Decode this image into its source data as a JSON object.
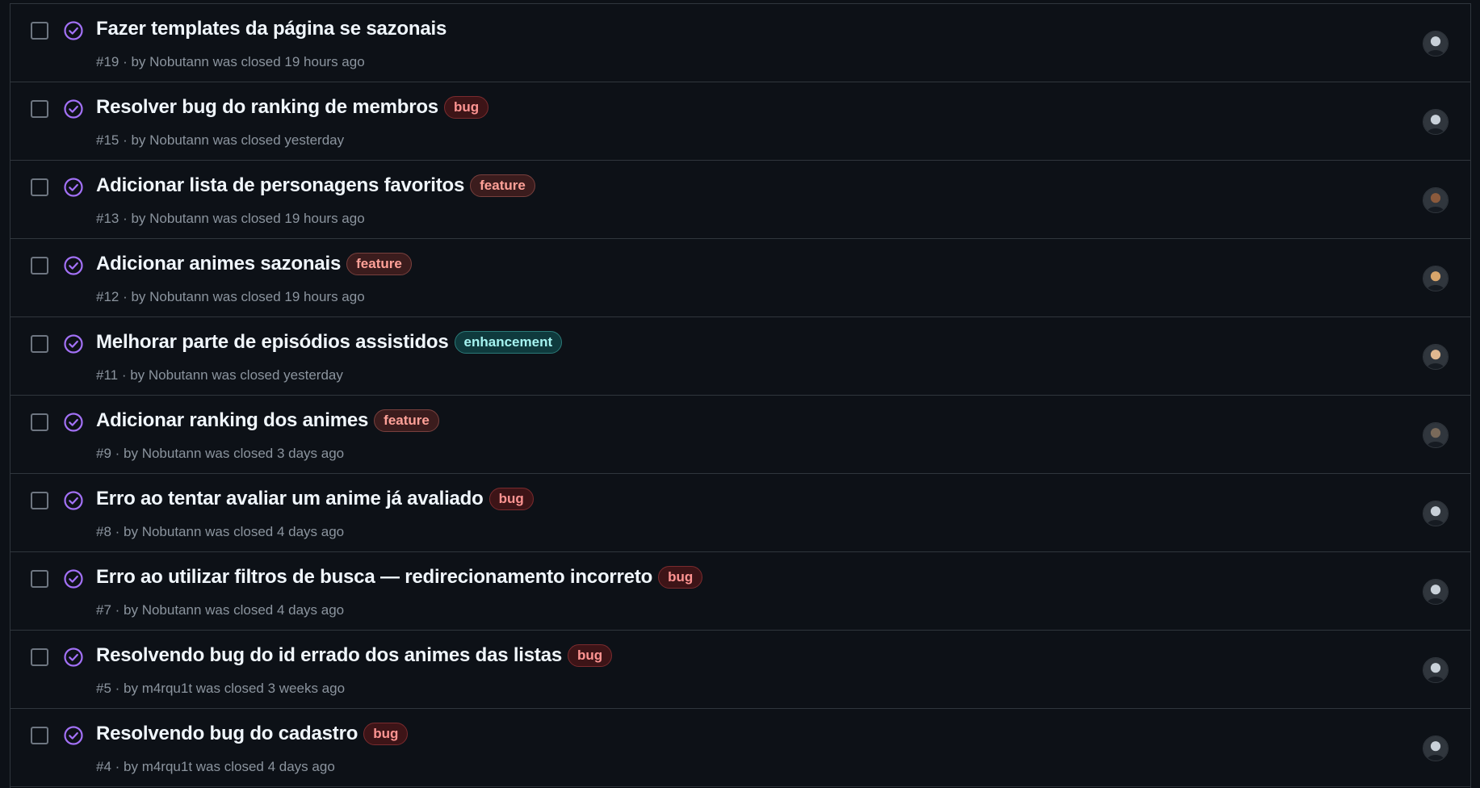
{
  "issues": [
    {
      "number": "#19",
      "title": "Fazer templates da página se sazonais",
      "label": "",
      "label_type": "",
      "meta": "#19 · by Nobutann was closed 19 hours ago",
      "avatar_color": "#c9d1d9"
    },
    {
      "number": "#15",
      "title": "Resolver bug do ranking de membros",
      "label": "bug",
      "label_type": "bug",
      "meta": "#15 · by Nobutann was closed yesterday",
      "avatar_color": "#c9d1d9"
    },
    {
      "number": "#13",
      "title": "Adicionar lista de personagens favoritos",
      "label": "feature",
      "label_type": "feature",
      "meta": "#13 · by Nobutann was closed 19 hours ago",
      "avatar_color": "#8b5a3c"
    },
    {
      "number": "#12",
      "title": "Adicionar animes sazonais",
      "label": "feature",
      "label_type": "feature",
      "meta": "#12 · by Nobutann was closed 19 hours ago",
      "avatar_color": "#d8a56b"
    },
    {
      "number": "#11",
      "title": "Melhorar parte de episódios assistidos",
      "label": "enhancement",
      "label_type": "enhancement",
      "meta": "#11 · by Nobutann was closed yesterday",
      "avatar_color": "#e0b890"
    },
    {
      "number": "#9",
      "title": "Adicionar ranking dos animes",
      "label": "feature",
      "label_type": "feature",
      "meta": "#9 · by Nobutann was closed 3 days ago",
      "avatar_color": "#7a6a5a"
    },
    {
      "number": "#8",
      "title": "Erro ao tentar avaliar um anime já avaliado",
      "label": "bug",
      "label_type": "bug",
      "meta": "#8 · by Nobutann was closed 4 days ago",
      "avatar_color": "#c9d1d9"
    },
    {
      "number": "#7",
      "title": "Erro ao utilizar filtros de busca — redirecionamento incorreto",
      "label": "bug",
      "label_type": "bug",
      "meta": "#7 · by Nobutann was closed 4 days ago",
      "avatar_color": "#c9d1d9"
    },
    {
      "number": "#5",
      "title": "Resolvendo bug do id errado dos animes das listas",
      "label": "bug",
      "label_type": "bug",
      "meta": "#5 · by m4rqu1t was closed 3 weeks ago",
      "avatar_color": "#c9d1d9"
    },
    {
      "number": "#4",
      "title": "Resolvendo bug do cadastro",
      "label": "bug",
      "label_type": "bug",
      "meta": "#4 · by m4rqu1t was closed 4 days ago",
      "avatar_color": "#c9d1d9"
    }
  ],
  "colors": {
    "background": "#0d1117",
    "closed_icon": "#a371f7",
    "title_text": "#f0f6fc",
    "meta_text": "#8b949e",
    "border": "#30363d"
  },
  "icons": {
    "closed": "issue-closed-icon"
  }
}
